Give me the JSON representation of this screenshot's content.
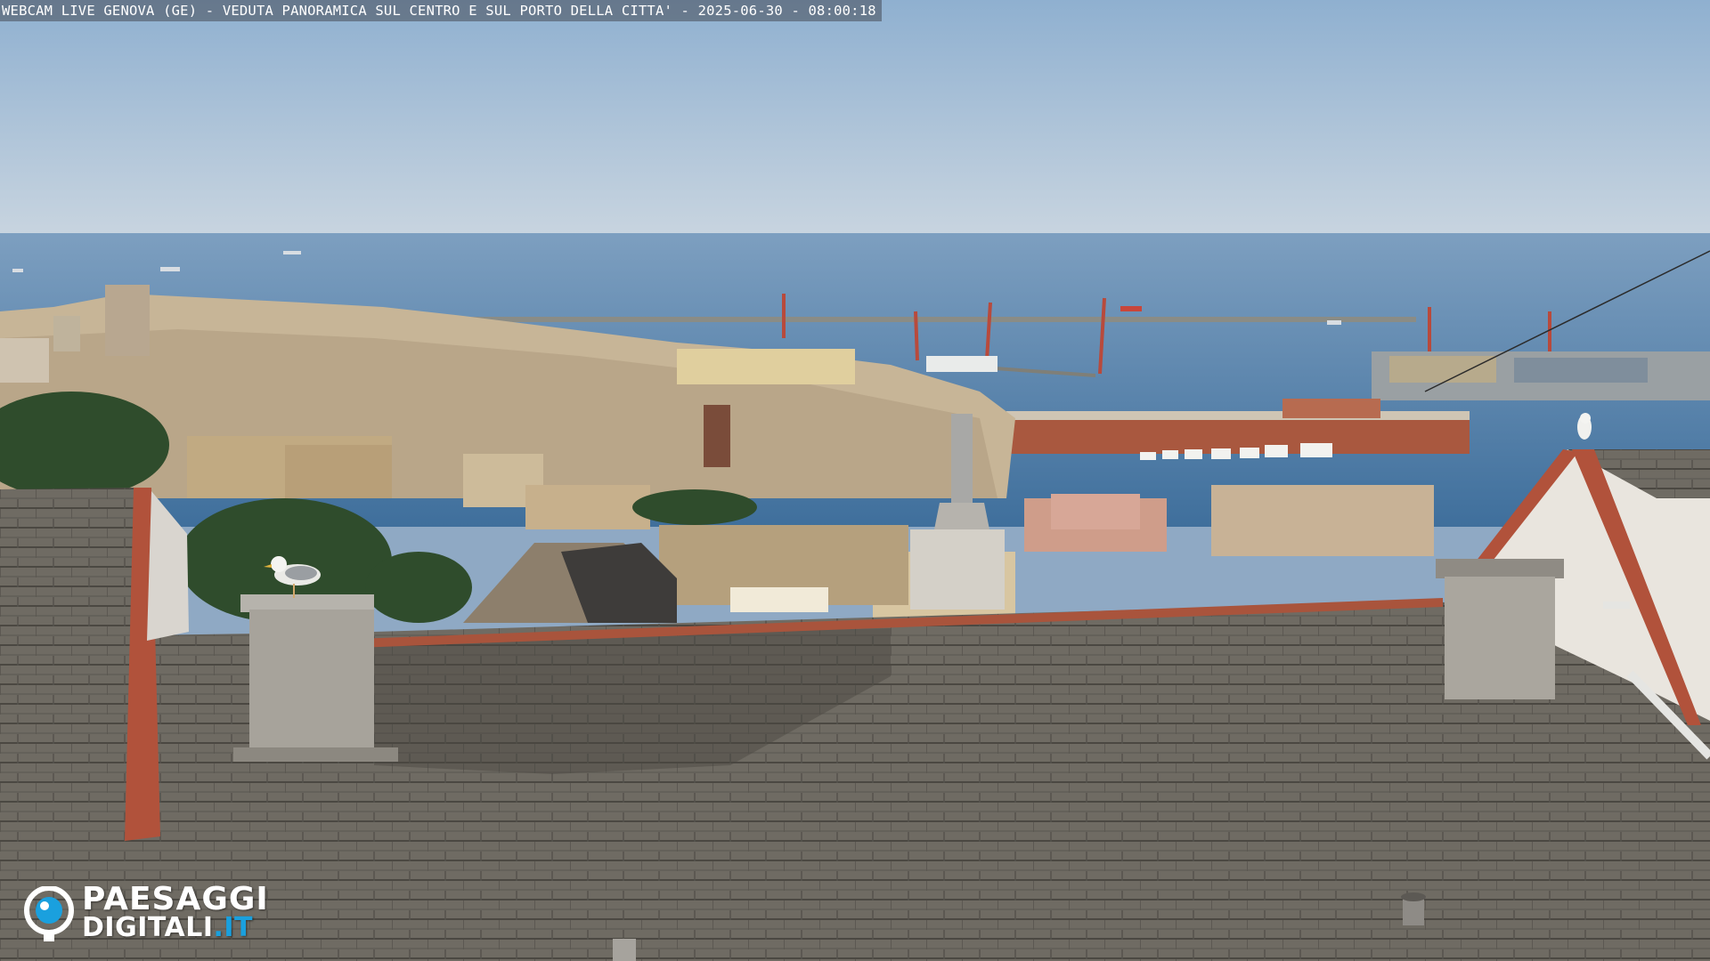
{
  "overlay": {
    "caption": "WEBCAM LIVE GENOVA (GE) - VEDUTA PANORAMICA SUL CENTRO E SUL PORTO DELLA CITTA' - 2025-06-30 - 08:00:18"
  },
  "logo": {
    "line1": "PAESAGGI",
    "line2_main": "DIGITALI",
    "line2_suffix": ".IT",
    "icon": "webcam-eye-icon"
  },
  "scene": {
    "subject": "harbour-city-panorama",
    "colors": {
      "sky_top": "#8fb0d0",
      "sky_horizon": "#c9d5e0",
      "sea": "#4a79a6",
      "roof_slate": "#6e6a62",
      "roof_tile_edge": "#b5533a",
      "city_buildings": "#c9b89a",
      "logo_accent": "#1aa0de"
    }
  }
}
